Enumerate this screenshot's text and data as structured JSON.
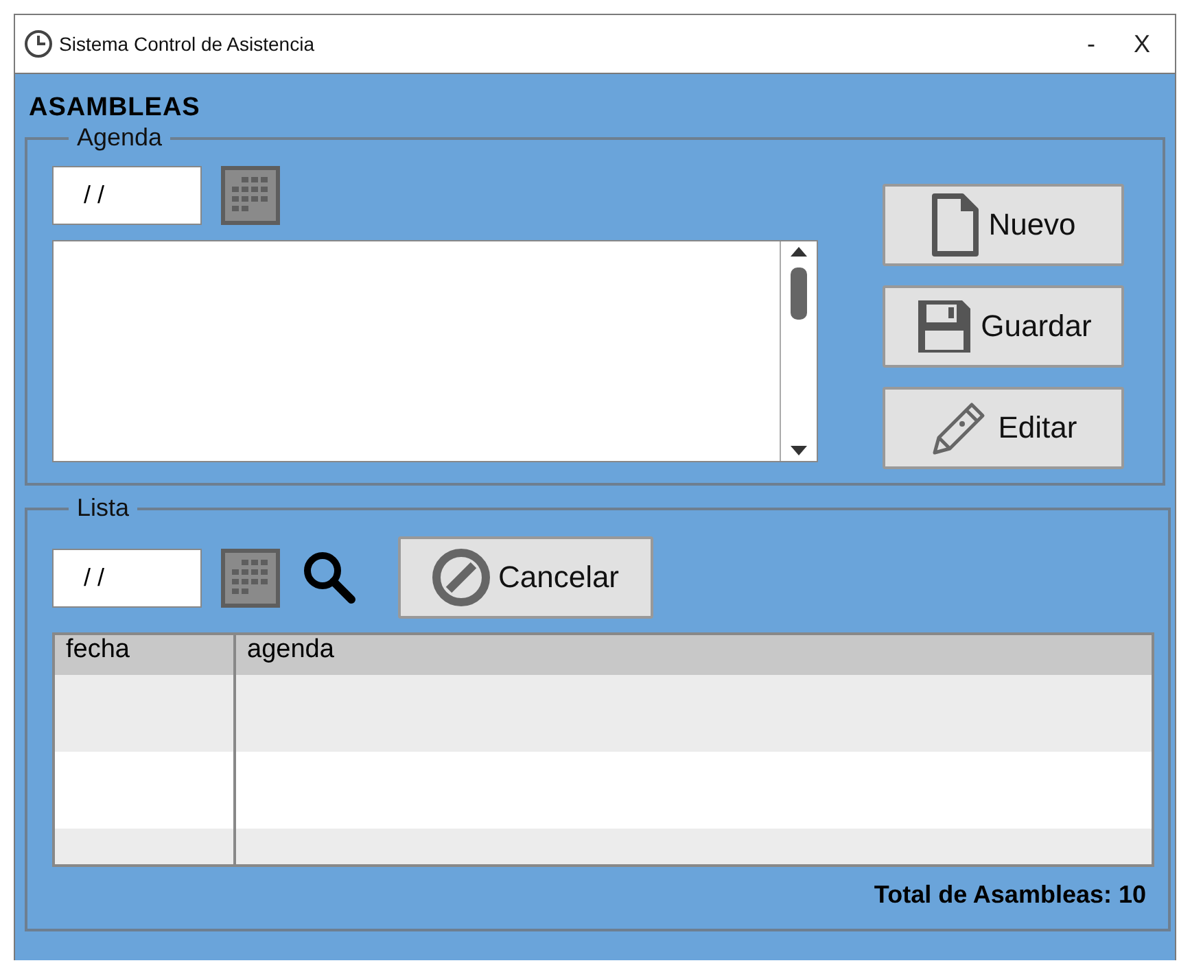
{
  "window": {
    "title": "Sistema Control de Asistencia",
    "controls": [
      "-",
      "X"
    ]
  },
  "heading": "ASAMBLEAS",
  "agenda": {
    "legend": "Agenda",
    "date": "/ /",
    "buttons": [
      {
        "kind": "new",
        "label": "Nuevo"
      },
      {
        "kind": "save",
        "label": "Guardar"
      },
      {
        "kind": "edit",
        "label": "Editar"
      }
    ]
  },
  "lista": {
    "legend": "Lista",
    "date": "/ /",
    "cancel": "Cancelar",
    "table": {
      "columns": [
        "fecha",
        "agenda"
      ]
    }
  },
  "total": "Total de Asambleas: 10"
}
